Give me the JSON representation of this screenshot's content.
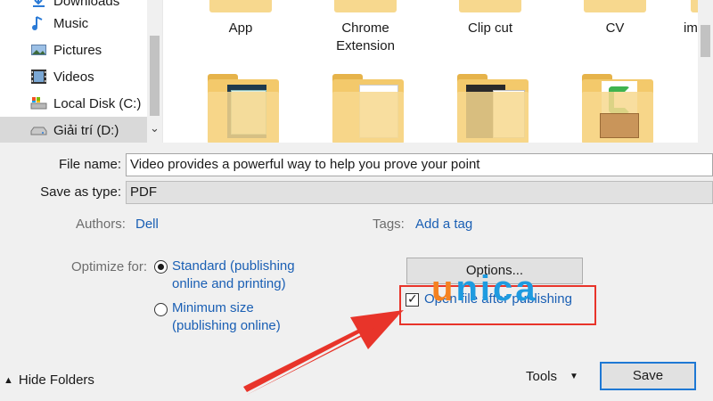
{
  "nav": {
    "items": [
      {
        "label": "Downloads",
        "icon": "download-icon"
      },
      {
        "label": "Music",
        "icon": "music-icon"
      },
      {
        "label": "Pictures",
        "icon": "pictures-icon"
      },
      {
        "label": "Videos",
        "icon": "videos-icon"
      },
      {
        "label": "Local Disk (C:)",
        "icon": "disk-icon"
      },
      {
        "label": "Giải trí (D:)",
        "icon": "drive-icon",
        "selected": true
      }
    ]
  },
  "files": {
    "row1": [
      "App",
      "Chrome\nExtension",
      "Clip cut",
      "CV",
      "im"
    ],
    "row1_parts": {
      "chrome1": "Chrome",
      "chrome2": "Extension"
    }
  },
  "form": {
    "file_name_label": "File name:",
    "file_name_value": "Video provides a powerful way to help you prove your point",
    "save_type_label": "Save as type:",
    "save_type_value": "PDF",
    "authors_label": "Authors:",
    "authors_value": "Dell",
    "tags_label": "Tags:",
    "tags_value": "Add a tag",
    "optimize_label": "Optimize for:",
    "opt_standard_line1": "Standard (publishing",
    "opt_standard_line2": "online and printing)",
    "opt_min_line1": "Minimum size",
    "opt_min_line2": "(publishing online)",
    "options_button": "Options...",
    "open_after_label": "Open file after publishing",
    "open_after_checked": true
  },
  "footer": {
    "hide_folders": "Hide Folders",
    "tools": "Tools",
    "save": "Save"
  },
  "overlay": {
    "watermark": "unica",
    "arrow_color": "#e8342a",
    "highlight_color": "#e8342a"
  }
}
